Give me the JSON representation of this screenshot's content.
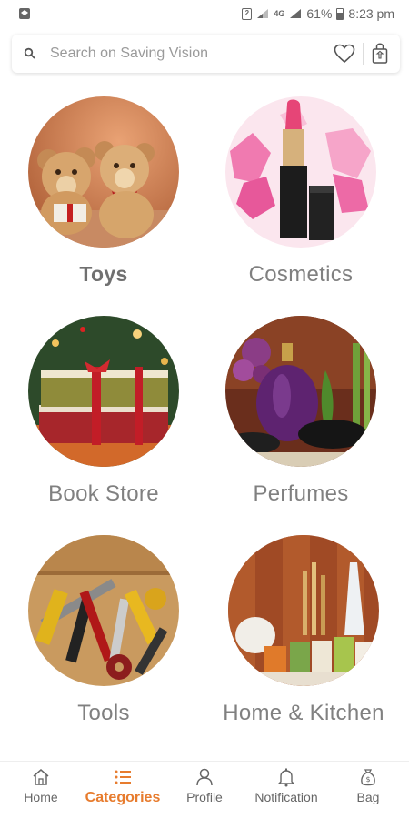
{
  "status_bar": {
    "battery": "61%",
    "time": "8:23 pm",
    "sim_label": "2",
    "network_label": "4G"
  },
  "search": {
    "placeholder": "Search on Saving Vision"
  },
  "categories": [
    {
      "label": "Toys",
      "image": "teddy-bears"
    },
    {
      "label": "Cosmetics",
      "image": "lipstick"
    },
    {
      "label": "Book Store",
      "image": "gift-books"
    },
    {
      "label": "Perfumes",
      "image": "perfume-orchid"
    },
    {
      "label": "Tools",
      "image": "hand-tools"
    },
    {
      "label": "Home & Kitchen",
      "image": "kitchenware"
    }
  ],
  "bottom_nav": [
    {
      "label": "Home",
      "icon": "home-icon",
      "active": false
    },
    {
      "label": "Categories",
      "icon": "list-icon",
      "active": true
    },
    {
      "label": "Profile",
      "icon": "person-icon",
      "active": false
    },
    {
      "label": "Notification",
      "icon": "bell-icon",
      "active": false
    },
    {
      "label": "Bag",
      "icon": "money-bag-icon",
      "active": false
    }
  ],
  "colors": {
    "accent": "#e77c2e",
    "label": "#707070"
  }
}
